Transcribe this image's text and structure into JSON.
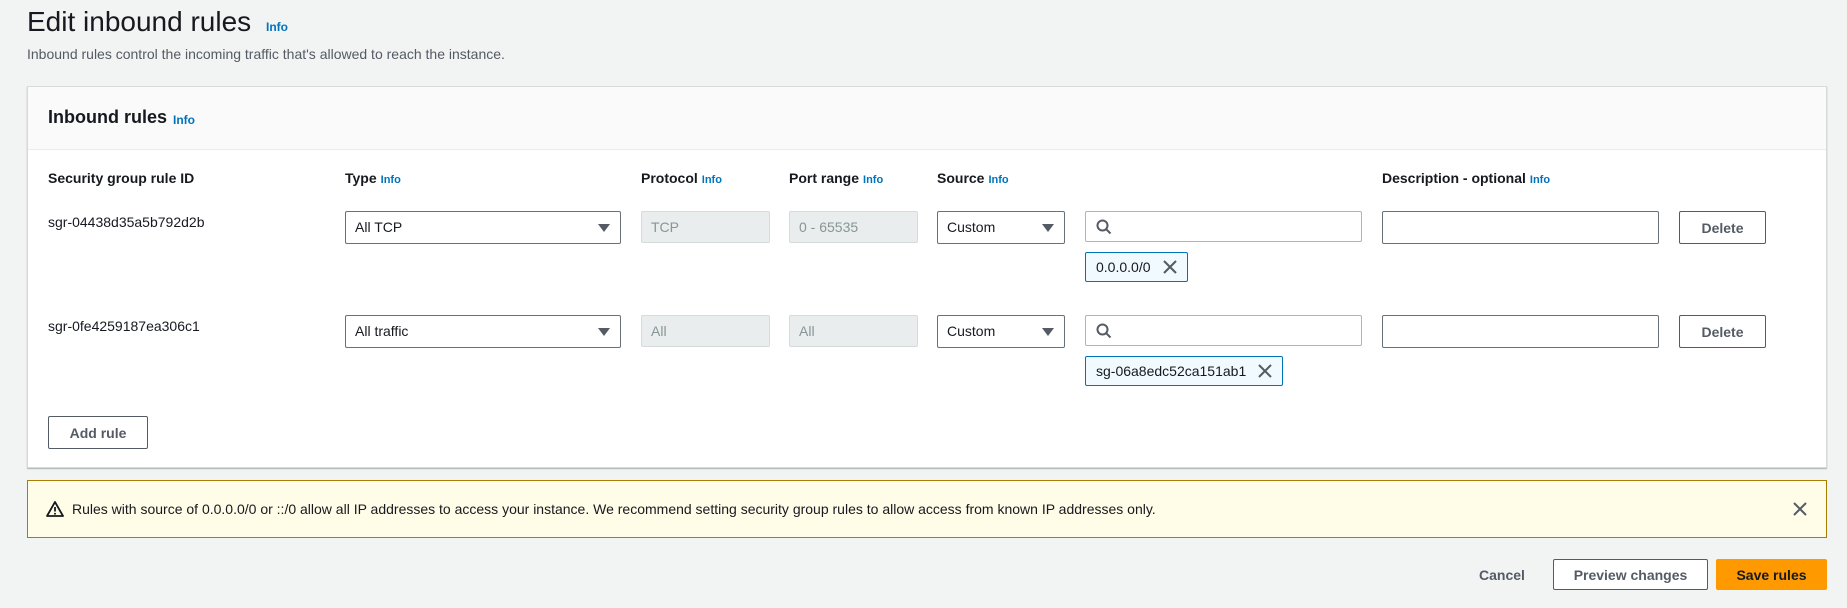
{
  "page": {
    "title": "Edit inbound rules",
    "title_info": "Info",
    "description": "Inbound rules control the incoming traffic that's allowed to reach the instance."
  },
  "card": {
    "title": "Inbound rules",
    "info": "Info",
    "columns": {
      "rule_id": "Security group rule ID",
      "type": "Type",
      "protocol": "Protocol",
      "port_range": "Port range",
      "source": "Source",
      "description": "Description - optional",
      "info": "Info"
    },
    "rows": [
      {
        "rule_id": "sgr-04438d35a5b792d2b",
        "type": "All TCP",
        "protocol": "TCP",
        "port_range": "0 - 65535",
        "source": "Custom",
        "source_search": "",
        "token": "0.0.0.0/0",
        "description": "",
        "delete_label": "Delete"
      },
      {
        "rule_id": "sgr-0fe4259187ea306c1",
        "type": "All traffic",
        "protocol": "All",
        "port_range": "All",
        "source": "Custom",
        "source_search": "",
        "token": "sg-06a8edc52ca151ab1",
        "description": "",
        "delete_label": "Delete"
      }
    ],
    "add_rule_label": "Add rule"
  },
  "alert": {
    "text": "Rules with source of 0.0.0.0/0 or ::/0 allow all IP addresses to access your instance. We recommend setting security group rules to allow access from known IP addresses only."
  },
  "footer": {
    "cancel_label": "Cancel",
    "preview_label": "Preview changes",
    "save_label": "Save rules"
  },
  "colors": {
    "accent": "#ff9900",
    "link": "#0073bb",
    "warning_bg": "#fffce8"
  }
}
